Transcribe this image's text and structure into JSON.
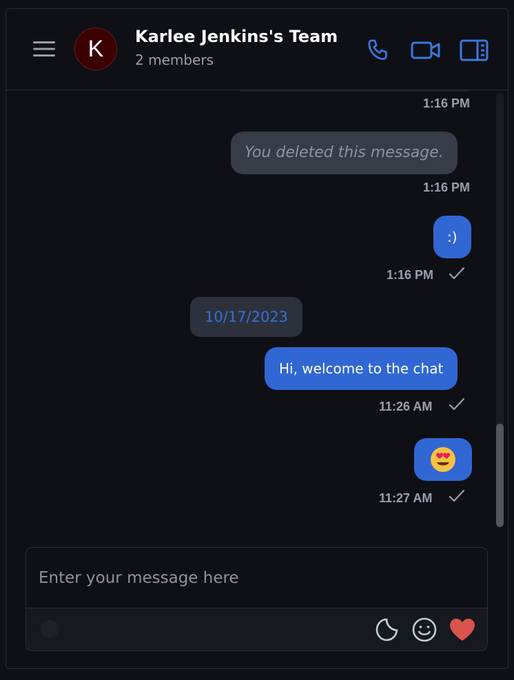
{
  "header": {
    "avatar_initial": "K",
    "title": "Karlee Jenkins's Team",
    "subtitle": "2 members"
  },
  "icons": {
    "menu": "hamburger-menu-icon",
    "call": "phone-icon",
    "video": "video-camera-icon",
    "details": "sidebar-panel-icon",
    "attach": "paperclip-icon",
    "sticker": "sticker-icon",
    "emoji": "smiley-icon",
    "reaction": "heart-icon"
  },
  "colors": {
    "accent": "#3067d3",
    "background": "#0f1016",
    "deleted_bubble": "#373c47",
    "avatar": "#3c0000",
    "heart": "#d9534f"
  },
  "messages": [
    {
      "type": "time_only",
      "time": "1:16 PM"
    },
    {
      "type": "deleted",
      "text": "You deleted this message.",
      "time": "1:16 PM"
    },
    {
      "type": "sent",
      "text": ":)",
      "time": "1:16 PM",
      "status": "sent"
    },
    {
      "type": "date_separator",
      "text": "10/17/2023"
    },
    {
      "type": "sent",
      "text": "Hi, welcome to the chat",
      "time": "11:26 AM",
      "status": "sent"
    },
    {
      "type": "sent",
      "text": "😍",
      "time": "11:27 AM",
      "status": "sent"
    }
  ],
  "composer": {
    "placeholder": "Enter your message here",
    "value": ""
  }
}
